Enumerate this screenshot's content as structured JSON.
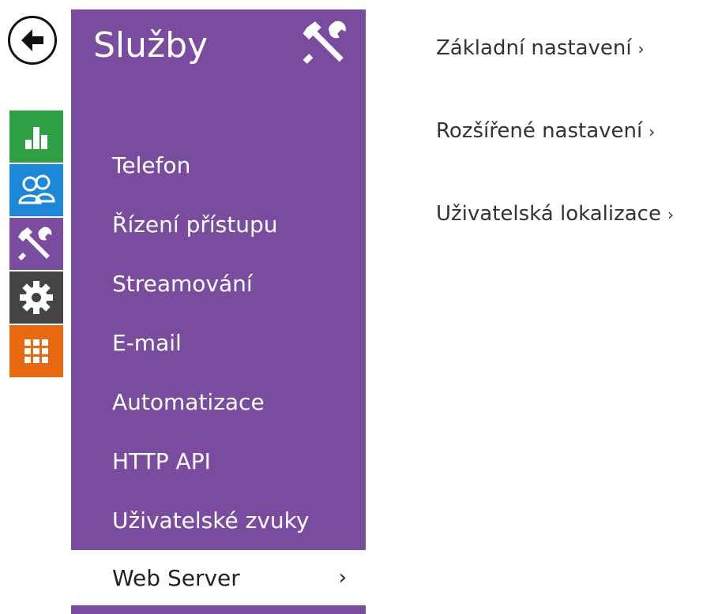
{
  "back": {
    "icon": "back-arrow-icon"
  },
  "rail": {
    "items": [
      {
        "name": "status",
        "icon": "bar-chart-icon",
        "color": "#2ea043"
      },
      {
        "name": "directory",
        "icon": "users-icon",
        "color": "#1e88d8"
      },
      {
        "name": "services",
        "icon": "tools-icon",
        "color": "#7a4c9f"
      },
      {
        "name": "hardware",
        "icon": "gear-icon",
        "color": "#444444"
      },
      {
        "name": "system",
        "icon": "grid-icon",
        "color": "#e8690f"
      }
    ]
  },
  "menu": {
    "title": "Služby",
    "title_icon": "tools-icon",
    "accent": "#7a4c9f",
    "items": [
      {
        "label": "Telefon"
      },
      {
        "label": "Řízení přístupu"
      },
      {
        "label": "Streamování"
      },
      {
        "label": "E-mail"
      },
      {
        "label": "Automatizace"
      },
      {
        "label": "HTTP API"
      },
      {
        "label": "Uživatelské zvuky"
      },
      {
        "label": "Web Server",
        "active": true,
        "chevron": "›"
      }
    ]
  },
  "content": {
    "links": [
      {
        "label": "Základní nastavení",
        "arrow": "›"
      },
      {
        "label": "Rozšířené nastavení",
        "arrow": "›"
      },
      {
        "label": "Uživatelská lokalizace",
        "arrow": "›"
      }
    ]
  }
}
